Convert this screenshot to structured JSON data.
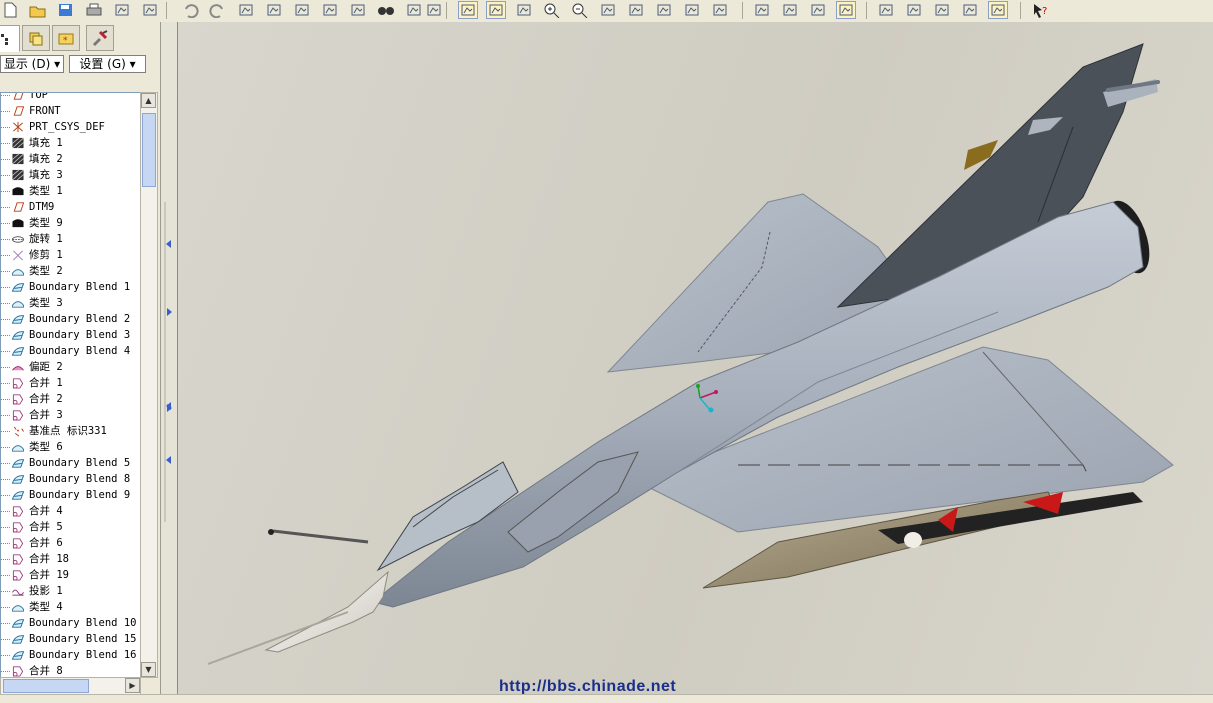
{
  "toolbar": {
    "buttons": [
      "new-file",
      "open-file",
      "save",
      "print",
      "send-mail",
      "disabled-tool",
      "undo",
      "redo",
      "cut",
      "copy",
      "paste",
      "paste-special",
      "regenerate",
      "find",
      "select-box",
      "select-dropdown",
      "repaint",
      "spin-center",
      "orient-mode",
      "zoom-in",
      "zoom-out",
      "refit",
      "reorient",
      "view-manager",
      "layers",
      "saved-views",
      "wireframe",
      "hidden-line",
      "no-hidden",
      "shading",
      "datum-planes",
      "datum-axes",
      "point-display",
      "csys-display",
      "annotation-display",
      "context-help"
    ]
  },
  "left_panel": {
    "tabs": [
      "model-tree",
      "layer-tree",
      "favorites",
      "tools"
    ],
    "show_menu": "显示 (D)",
    "settings_menu": "设置 (G)",
    "tree_items": [
      {
        "label": "TOP",
        "icon": "datum-plane-icon"
      },
      {
        "label": "FRONT",
        "icon": "datum-plane-icon"
      },
      {
        "label": "PRT_CSYS_DEF",
        "icon": "csys-icon"
      },
      {
        "label": "填充 1",
        "icon": "fill-icon"
      },
      {
        "label": "填充 2",
        "icon": "fill-icon"
      },
      {
        "label": "填充 3",
        "icon": "fill-icon"
      },
      {
        "label": "类型 1",
        "icon": "solid-type-icon"
      },
      {
        "label": "DTM9",
        "icon": "datum-plane-icon"
      },
      {
        "label": "类型 9",
        "icon": "solid-type-icon"
      },
      {
        "label": "旋转 1",
        "icon": "revolve-icon"
      },
      {
        "label": "修剪 1",
        "icon": "trim-icon"
      },
      {
        "label": "类型 2",
        "icon": "surface-type-icon"
      },
      {
        "label": "Boundary Blend 1",
        "icon": "boundary-blend-icon"
      },
      {
        "label": "类型 3",
        "icon": "surface-type-icon"
      },
      {
        "label": "Boundary Blend 2",
        "icon": "boundary-blend-icon"
      },
      {
        "label": "Boundary Blend 3",
        "icon": "boundary-blend-icon"
      },
      {
        "label": "Boundary Blend 4",
        "icon": "boundary-blend-icon"
      },
      {
        "label": "偏距 2",
        "icon": "offset-icon"
      },
      {
        "label": "合并 1",
        "icon": "merge-icon"
      },
      {
        "label": "合并 2",
        "icon": "merge-icon"
      },
      {
        "label": "合并 3",
        "icon": "merge-icon"
      },
      {
        "label": "基准点 标识331",
        "icon": "datum-point-icon"
      },
      {
        "label": "类型 6",
        "icon": "surface-type-icon"
      },
      {
        "label": "Boundary Blend 5",
        "icon": "boundary-blend-icon"
      },
      {
        "label": "Boundary Blend 8",
        "icon": "boundary-blend-icon"
      },
      {
        "label": "Boundary Blend 9",
        "icon": "boundary-blend-icon"
      },
      {
        "label": "合并 4",
        "icon": "merge-icon"
      },
      {
        "label": "合并 5",
        "icon": "merge-icon"
      },
      {
        "label": "合并 6",
        "icon": "merge-icon"
      },
      {
        "label": "合并 18",
        "icon": "merge-icon"
      },
      {
        "label": "合并 19",
        "icon": "merge-icon"
      },
      {
        "label": "投影 1",
        "icon": "project-icon"
      },
      {
        "label": "类型 4",
        "icon": "surface-type-icon"
      },
      {
        "label": "Boundary Blend 10",
        "icon": "boundary-blend-icon"
      },
      {
        "label": "Boundary Blend 15",
        "icon": "boundary-blend-icon"
      },
      {
        "label": "Boundary Blend 16",
        "icon": "boundary-blend-icon"
      },
      {
        "label": "合并 8",
        "icon": "merge-icon"
      }
    ]
  },
  "viewport": {
    "watermark": "http://bbs.chinade.net",
    "model": "delta-wing-jet-fighter"
  },
  "colors": {
    "fuselage": "#a8b1bd",
    "tail": "#4a5058",
    "nose": "#f2f0e6",
    "missile_fin": "#c81818"
  }
}
